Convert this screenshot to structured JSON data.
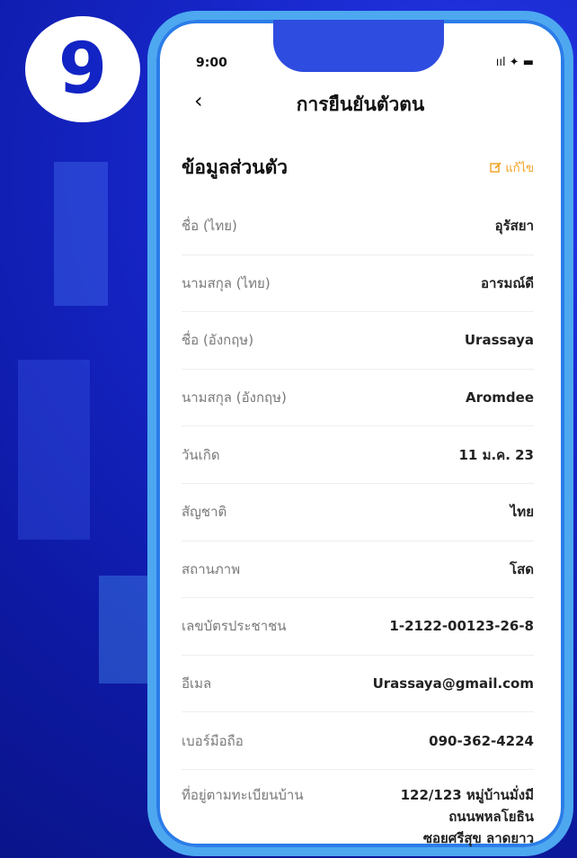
{
  "step": "9",
  "status": {
    "time": "9:00",
    "icons": "ııl ✦ ▬"
  },
  "nav": {
    "back": "‹",
    "title": "การยืนยันตัวตน"
  },
  "section": {
    "title": "ข้อมูลส่วนตัว",
    "edit_label": "แก้ไข",
    "edit_icon": "edit-icon"
  },
  "rows": [
    {
      "label": "ชื่อ (ไทย)",
      "value": "อุรัสยา"
    },
    {
      "label": "นามสกุล (ไทย)",
      "value": "อารมณ์ดี"
    },
    {
      "label": "ชื่อ (อังกฤษ)",
      "value": "Urassaya"
    },
    {
      "label": "นามสกุล (อังกฤษ)",
      "value": "Aromdee"
    },
    {
      "label": "วันเกิด",
      "value": "11 ม.ค. 23"
    },
    {
      "label": "สัญชาติ",
      "value": "ไทย"
    },
    {
      "label": "สถานภาพ",
      "value": "โสด"
    },
    {
      "label": "เลขบัตรประชาชน",
      "value": "1-2122-00123-26-8"
    },
    {
      "label": "อีเมล",
      "value": "Urassaya@gmail.com"
    },
    {
      "label": "เบอร์มือถือ",
      "value": "090-362-4224"
    }
  ],
  "address": {
    "label": "ที่อยู่ตามทะเบียนบ้าน",
    "line1": "122/123 หมู่บ้านมั่งมี",
    "line2": "ถนนพหลโยธิน",
    "line3": "ซอยศรีสุข ลาดยาว"
  }
}
